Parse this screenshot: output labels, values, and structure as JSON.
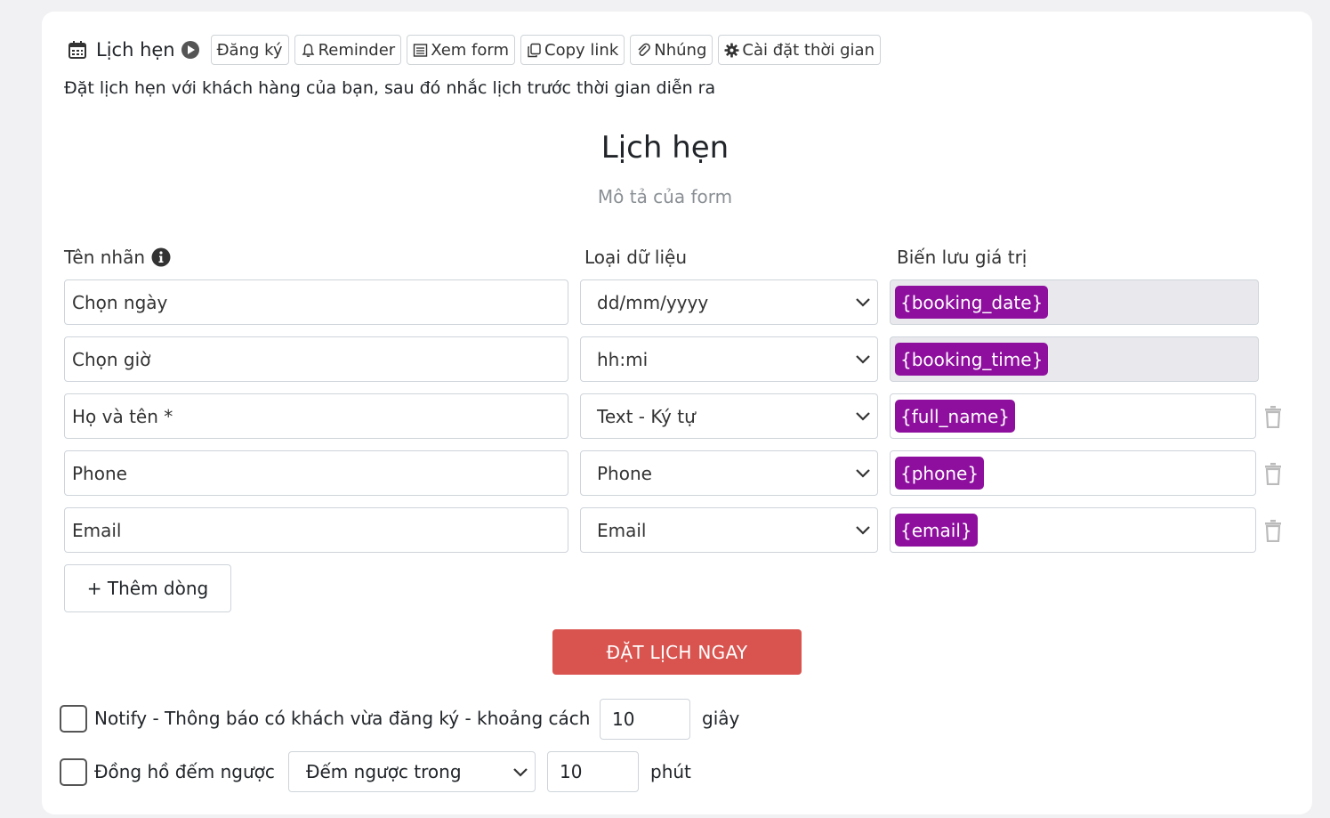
{
  "toolbar": {
    "title": "Lịch hẹn",
    "buttons": [
      {
        "label": "Đăng ký",
        "icon": "none"
      },
      {
        "label": "Reminder",
        "icon": "bell-icon"
      },
      {
        "label": "Xem form",
        "icon": "list-icon"
      },
      {
        "label": "Copy link",
        "icon": "copy-icon"
      },
      {
        "label": "Nhúng",
        "icon": "paperclip-icon"
      },
      {
        "label": "Cài đặt thời gian",
        "icon": "gear-icon"
      }
    ]
  },
  "description": "Đặt lịch hẹn với khách hàng của bạn, sau đó nhắc lịch trước thời gian diễn ra",
  "form": {
    "title": "Lịch hẹn",
    "subtitle": "Mô tả của form",
    "columns": {
      "label": "Tên nhãn",
      "type": "Loại dữ liệu",
      "variable": "Biến lưu giá trị"
    },
    "rows": [
      {
        "label": "Chọn ngày",
        "type": "dd/mm/yyyy",
        "variable": "{booking_date}",
        "readonly": true
      },
      {
        "label": "Chọn giờ",
        "type": "hh:mi",
        "variable": "{booking_time}",
        "readonly": true
      },
      {
        "label": "Họ và tên *",
        "type": "Text - Ký tự",
        "variable": "{full_name}",
        "readonly": false
      },
      {
        "label": "Phone",
        "type": "Phone",
        "variable": "{phone}",
        "readonly": false
      },
      {
        "label": "Email",
        "type": "Email",
        "variable": "{email}",
        "readonly": false
      }
    ],
    "add_row_label": "+ Thêm dòng",
    "submit_label": "ĐẶT LỊCH NGAY"
  },
  "options": {
    "notify_label": "Notify - Thông báo có khách vừa đăng ký - khoảng cách",
    "notify_value": "10",
    "notify_unit": "giây",
    "countdown_label": "Đồng hồ đếm ngược",
    "countdown_mode": "Đếm ngược trong",
    "countdown_value": "10",
    "countdown_unit": "phút"
  },
  "colors": {
    "chip": "#8e0f9e",
    "submit": "#d9534f",
    "readonly_bg": "#e9e9ed"
  }
}
